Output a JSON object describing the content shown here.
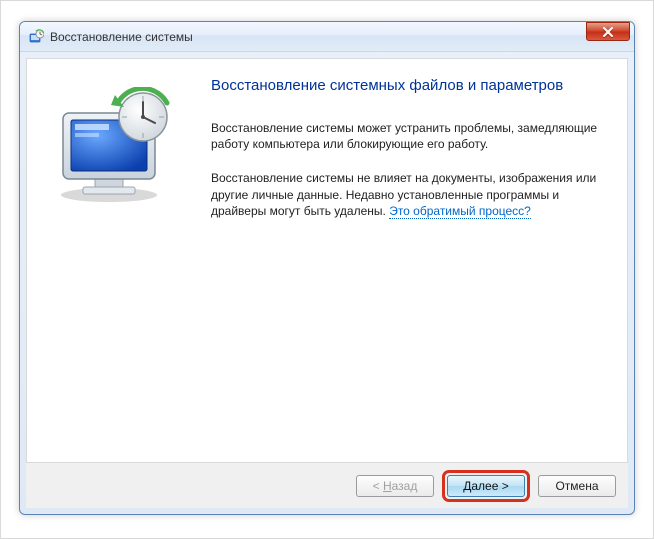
{
  "window": {
    "title": "Восстановление системы"
  },
  "page": {
    "heading": "Восстановление системных файлов и параметров",
    "para1": "Восстановление системы может устранить проблемы, замедляющие работу компьютера или блокирующие его работу.",
    "para2_before_link": "Восстановление системы не влияет на документы, изображения или другие личные данные. Недавно установленные программы и драйверы могут быть удалены. ",
    "para2_link": "Это обратимый процесс?"
  },
  "footer": {
    "back_prefix": "< ",
    "back_accel": "Н",
    "back_rest": "азад",
    "next_accel": "Д",
    "next_rest": "алее >",
    "cancel": "Отмена"
  }
}
